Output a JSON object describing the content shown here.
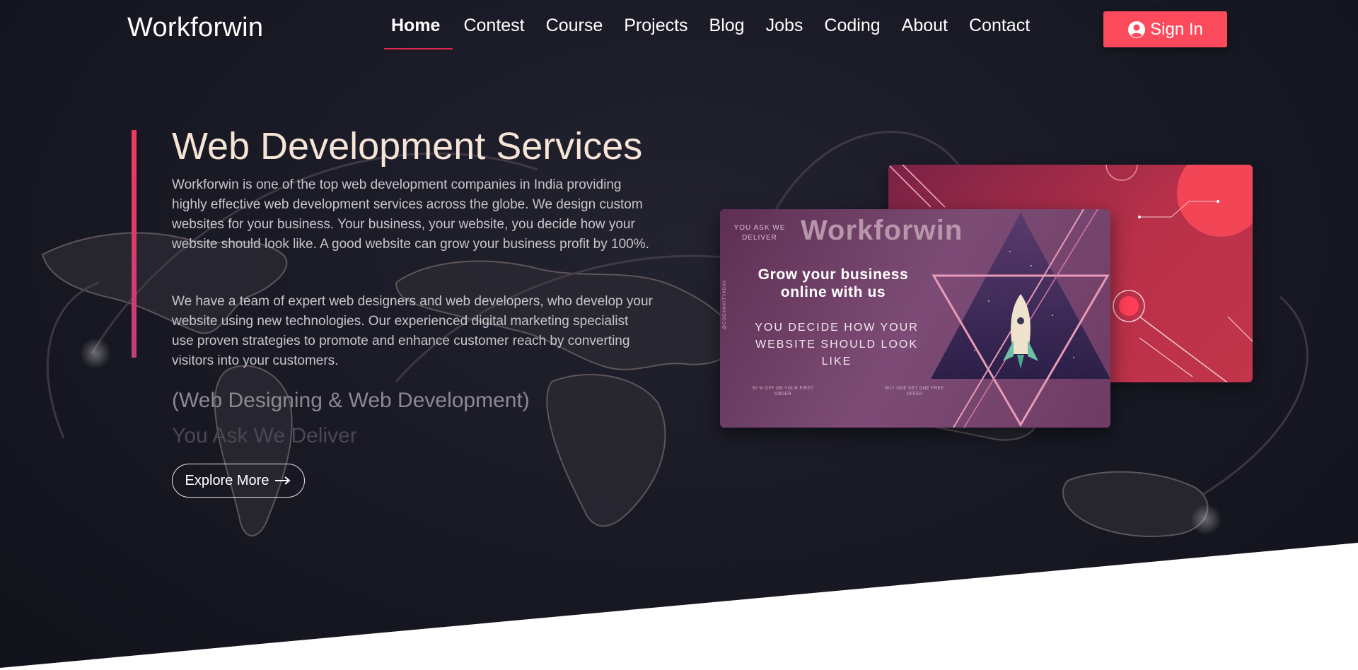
{
  "nav": {
    "brand": "Workforwin",
    "items": [
      {
        "label": "Home"
      },
      {
        "label": "Contest"
      },
      {
        "label": "Course"
      },
      {
        "label": "Projects"
      },
      {
        "label": "Blog"
      },
      {
        "label": "Jobs"
      },
      {
        "label": "Coding"
      },
      {
        "label": "About"
      },
      {
        "label": "Contact"
      }
    ],
    "active": "Home",
    "signin_label": "Sign In"
  },
  "hero": {
    "title": "Web Development Services",
    "paragraph1": "Workforwin is one of the top web development companies in India providing highly effective web development services across the globe. We design custom websites for your business. Your business, your website, you decide how your website should look like. A good website can grow your business profit by 100%.",
    "paragraph2": "We have a team of expert web designers and web developers, who develop your website using new technologies. Our experienced digital marketing specialist use proven strategies to promote and enhance customer reach by converting visitors into your customers.",
    "subtitle1": "(Web Designing & Web Development)",
    "subtitle2": "You Ask We Deliver",
    "explore_label": "Explore More"
  },
  "promo_card": {
    "small_text": "YOU ASK WE DELIVER",
    "brand": "Workforwin",
    "headline": "Grow your business online with us",
    "tagline": "YOU DECIDE HOW YOUR WEBSITE SHOULD LOOK LIKE",
    "offer1": "50 % OFF ON YOUR FIRST ORDER",
    "offer2": "BUY ONE GET ONE FREE OFFER",
    "side_text": "@CODANKITYADAV"
  },
  "colors": {
    "accent": "#fc4a5d",
    "accent_bar": "#e2264d",
    "hero_bg": "#1a1a26",
    "title": "#f6e5d6"
  },
  "icons": {
    "signin": "user-circle-icon",
    "explore": "arrow-right-icon"
  }
}
